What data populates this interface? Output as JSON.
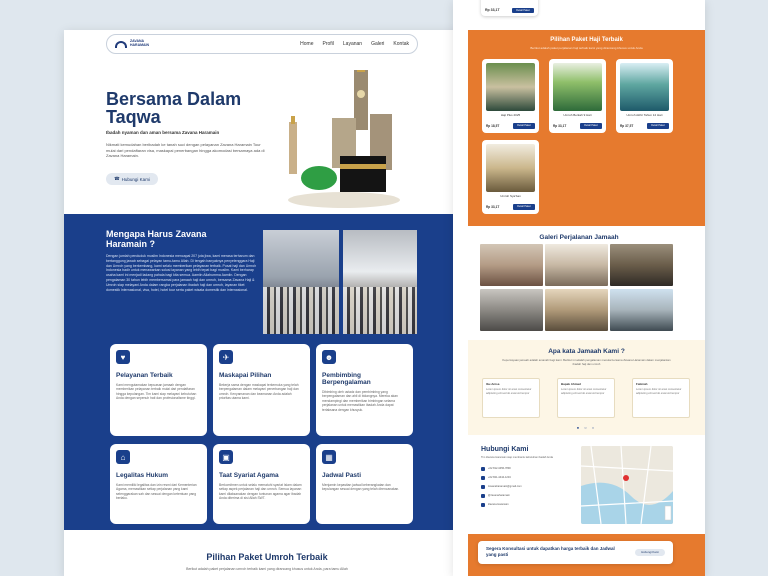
{
  "nav": {
    "logo_text_1": "ZAVANA",
    "logo_text_2": "HARAMAIN",
    "links": [
      "Home",
      "Profil",
      "Layanan",
      "Galeri",
      "Kontak"
    ]
  },
  "hero": {
    "title": "Bersama Dalam Taqwa",
    "subtitle": "Ibadah nyaman dan aman bersama Zavana Haramain",
    "description": "Nikmati kemudahan beribadah ke tanah suci dengan pelayanan Zavana Haramain Tour mulai dari pendaftaran visa, maskapai penerbangan hingga akomodasi bersamaya ada di Zavana Haramain.",
    "button": "Hubungi Kami"
  },
  "why": {
    "title": "Mengapa Harus Zavana Haramain ?",
    "paragraph": "Dengan jumlah penduduk muslim Indonesia mencapai 207 juta jiwa, kami merasa terharum dan bertanggung jawab sebagai pelayan tamu-tamu Allah. Di tengah banyaknya penyelenggara Haji dan Umroh yang berkembang, kami selalu memberikan pelayanan terbaik. Pusat haji dan Umroh Indonesia hadir untuk menawarkan solusi layanan yang lebih tepat bagi muslim. Kami berharap usaha kami ini menjadi ladang pahala bagi kita semua. Aamiin Allahumma Aamiin. Dengan pengalaman 30 tahun lebih membersamai para jamaah haji dan umroh, bersama Zavana Haji & Umroh siap melayani Anda dalam rangka perjalanan ibadah haji dan umroh, layanan tiket domestik internasional, visa, hotel, hotel tour serta paket wisata domestik dan internasional."
  },
  "cards": [
    {
      "icon": "hand-heart-icon",
      "glyph": "♥",
      "title": "Pelayanan Terbaik",
      "text": "Kami mengutamakan kepuasan jamaah dengan memberikan pelayanan terbaik mulai dari pendaftaran hingga kepulangan. Tim kami siap melayani kebutuhan Anda dengan sepenuh hati dan profesionalisme tinggi."
    },
    {
      "icon": "plane-icon",
      "glyph": "✈",
      "title": "Maskapai Pilihan",
      "text": "Bekerja sama dengan maskapai terkemuka yang telah berpengalaman dalam melayani penerbangan haji dan umroh. Kenyamanan dan keamanan Anda adalah prioritas utama kami."
    },
    {
      "icon": "people-icon",
      "glyph": "☻",
      "title": "Pembimbing Berpengalaman",
      "text": "Dibimbing oleh ustadz dan pembimbing yang berpengalaman dan ahli di bidangnya. Mereka akan mendampingi dan memberikan bimbingan selama perjalanan untuk memastikan ibadah Anda dapat terlaksana dengan khusyuk."
    },
    {
      "icon": "bank-icon",
      "glyph": "⌂",
      "title": "Legalitas Hukum",
      "text": "Kami memiliki legalitas dan izin resmi dari Kementerian Agama, memastikan setiap perjalanan yang kami selenggarakan sah dan sesuai dengan ketentuan yang berlaku."
    },
    {
      "icon": "kaaba-icon",
      "glyph": "▣",
      "title": "Taat Syariat Agama",
      "text": "Berkomitmen untuk selalu mematuhi syariat Islam dalam setiap aspek perjalanan haji dan umroh. Semua layanan kami dilaksanakan dengan tuntunan agama agar ibadah Anda diterima di sisi Allah SWT."
    },
    {
      "icon": "calendar-icon",
      "glyph": "▦",
      "title": "Jadwal Pasti",
      "text": "Menjamin kepastian jadwal keberangkatan dan kepulangan sesuai dengan yang telah direncanakan."
    }
  ],
  "umroh": {
    "title": "Pilihan Paket Umroh Terbaik",
    "subtitle": "Berikut adalah paket perjalanan umroh terbaik kami yang dirancang khusus untuk Anda, para tamu Allah"
  },
  "right_top": {
    "price": "Rp 33,1T",
    "detail": "Detail Paket"
  },
  "haji": {
    "title": "Pilihan Paket Haji Terbaik",
    "subtitle": "Berikut adalah paket perjalanan haji terbaik kami yang dirancang khusus untuk Anda",
    "packages": [
      {
        "name": "Haji Plus 2025",
        "price": "Rp 18,5T",
        "button": "Detail Paket"
      },
      {
        "name": "Umroh Berkah 9 Hari",
        "price": "Rp 33,1T",
        "button": "Detail Paket"
      },
      {
        "name": "Umroh Akhir Tahun 12 Hari",
        "price": "Rp 37,5T",
        "button": "Detail Paket"
      },
      {
        "name": "Umroh Sya'ban",
        "price": "Rp 33,1T",
        "button": "Detail Paket"
      }
    ]
  },
  "gallery": {
    "title": "Galeri Perjalanan Jamaah"
  },
  "testimonials": {
    "title": "Apa kata Jamaah Kami ?",
    "subtitle": "Kepercayaan jamaah adalah amanah bagi kami. Berikut ini adalah pengalaman mereka bersama Zavana Haramain dalam menjalankan ibadah haji dan umroh",
    "items": [
      {
        "name": "Ibu Anisa",
        "text": "Lorem ipsum dolor sit amet consectetur adipiscing elit sed do eiusmod tempor"
      },
      {
        "name": "Bapak Ahmad",
        "text": "Lorem ipsum dolor sit amet consectetur adipiscing elit sed do eiusmod tempor"
      },
      {
        "name": "Fatimah",
        "text": "Lorem ipsum dolor sit amet consectetur adipiscing elit sed do eiusmod tempor"
      }
    ],
    "dots": "● ○ ○"
  },
  "contact": {
    "title": "Hubungi Kami",
    "subtitle": "Tim Zavana Haramain siap membantu kebutuhan ibadah Anda",
    "items": [
      {
        "icon": "phone-icon",
        "text": "+62 812-3456-7890"
      },
      {
        "icon": "whatsapp-icon",
        "text": "+62 821-4444-1234"
      },
      {
        "icon": "mail-icon",
        "text": "zavanaharamain@gmail.com"
      },
      {
        "icon": "instagram-icon",
        "text": "@zavanaharamain"
      },
      {
        "icon": "facebook-icon",
        "text": "Zavana Haramain"
      }
    ]
  },
  "cta": {
    "text": "Segera Konsultasi untuk dapatkan harga terbaik dan Jadwal yang pasti",
    "button": "Hubungi Kami"
  }
}
